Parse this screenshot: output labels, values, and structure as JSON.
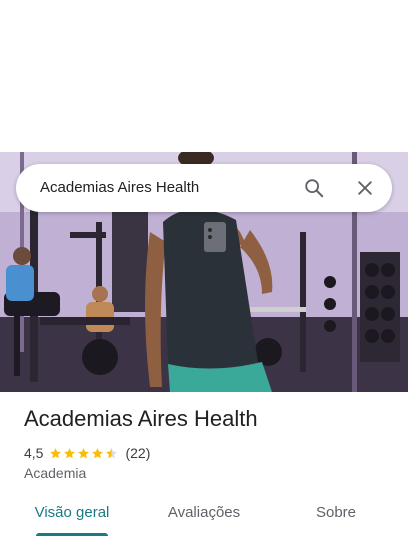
{
  "search": {
    "query": "Academias Aires Health"
  },
  "place": {
    "name": "Academias Aires Health",
    "rating_text": "4,5",
    "rating_value": 4.5,
    "review_count": "(22)",
    "category": "Academia"
  },
  "tabs": [
    {
      "label": "Visão geral",
      "active": true
    },
    {
      "label": "Avaliações",
      "active": false
    },
    {
      "label": "Sobre",
      "active": false
    }
  ],
  "colors": {
    "accent": "#1a7a83",
    "star": "#fbbc04",
    "title_text": "#202124",
    "secondary_text": "#5f6368"
  },
  "icons": [
    "search-icon",
    "close-icon",
    "star-icon"
  ]
}
